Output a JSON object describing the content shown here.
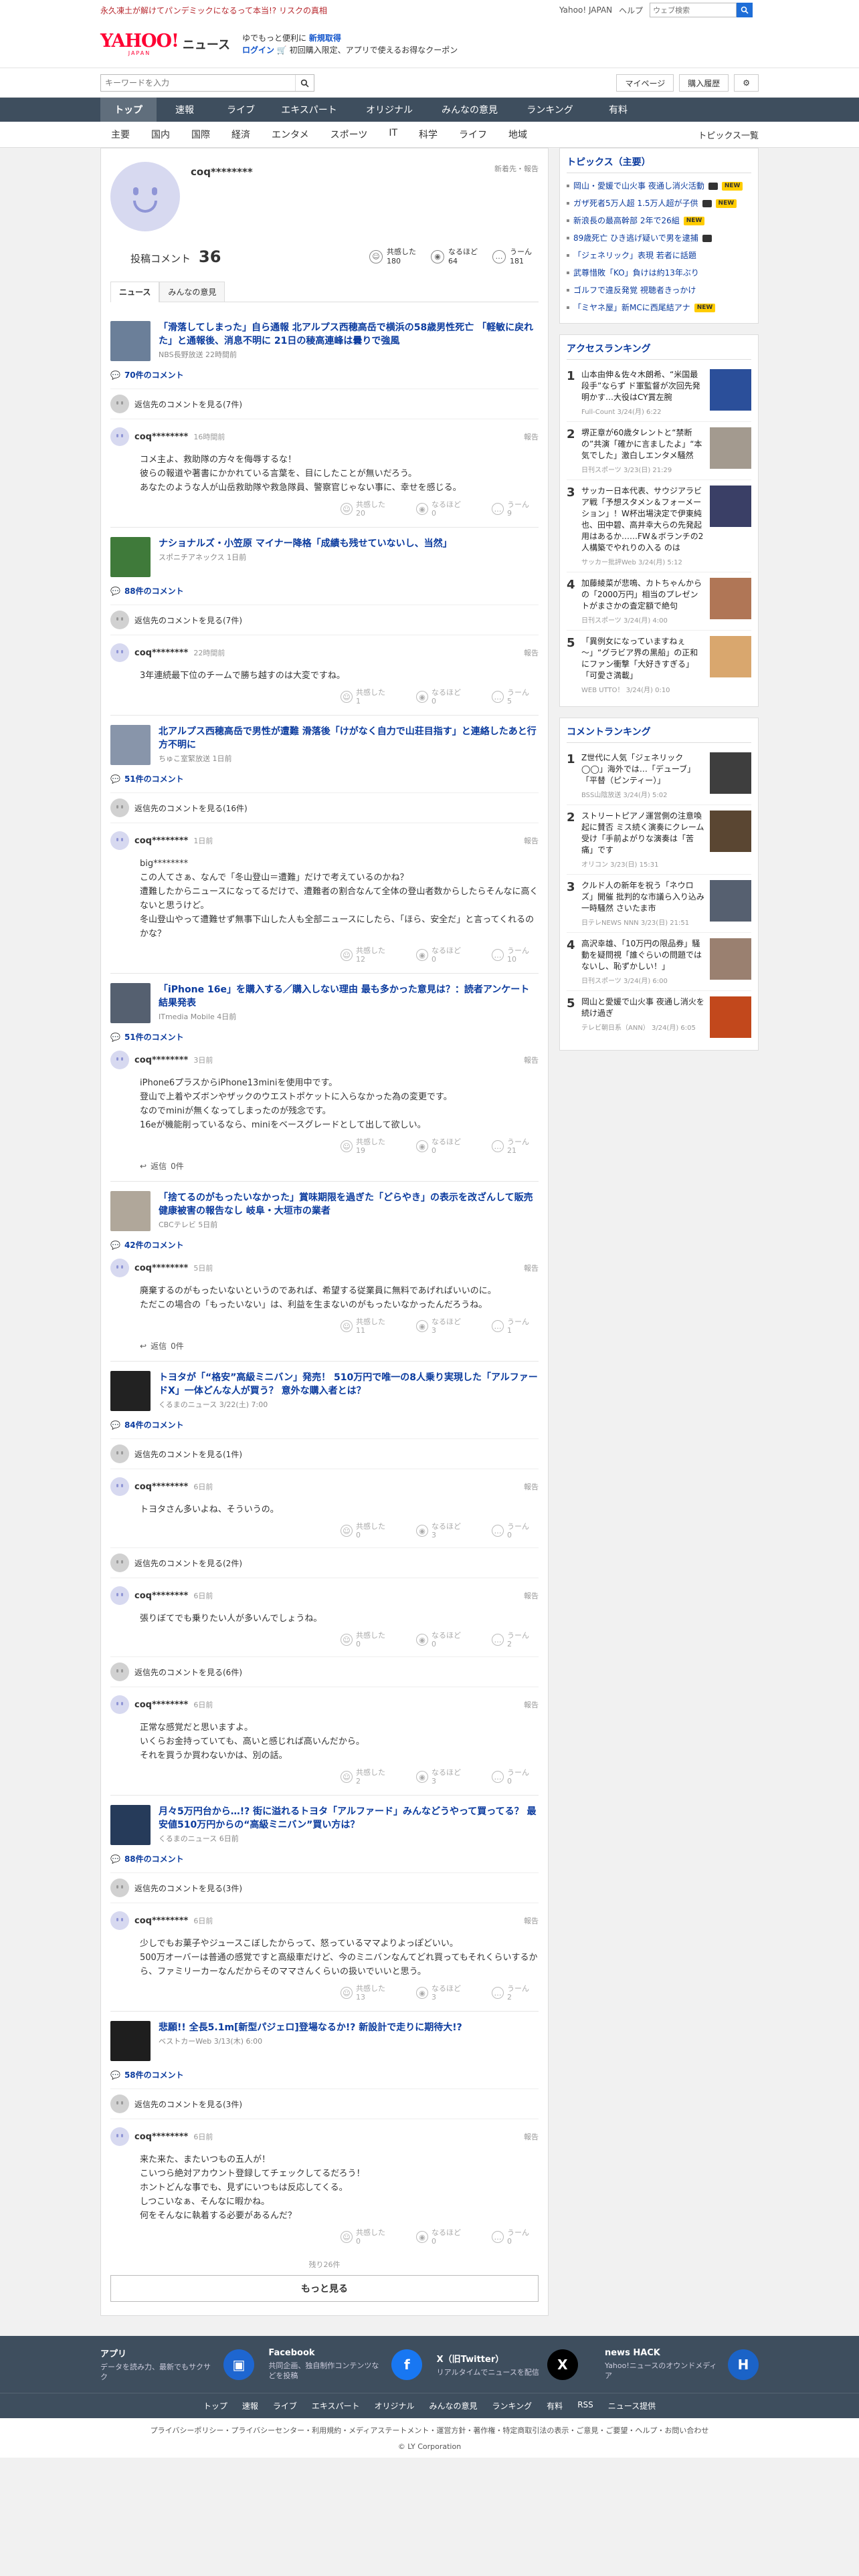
{
  "topbar": {
    "news_link": "永久凍土が解けてパンデミックになるって本当!? リスクの真相",
    "links": [
      "Yahoo! JAPAN",
      "ヘルプ"
    ],
    "search_placeholder": "ウェブ検索"
  },
  "header": {
    "logo": "YAHOO!",
    "logo_sub": "JAPAN",
    "logo_news": "ニュース",
    "promo_line1_a": "ゆでもっと便利に",
    "promo_line1_b": "新規取得",
    "promo_line2_a": "ログイン",
    "promo_line2_b": "初回購入限定、アプリで使えるお得なクーポン"
  },
  "searchrow": {
    "placeholder": "キーワードを入力",
    "mypage": "マイページ",
    "history": "購入履歴"
  },
  "gnav": [
    "トップ",
    "速報",
    "ライブ",
    "エキスパート",
    "オリジナル",
    "みんなの意見",
    "ランキング",
    "有料"
  ],
  "snav": {
    "cats": [
      "主要",
      "国内",
      "国際",
      "経済",
      "エンタメ",
      "スポーツ",
      "IT",
      "科学",
      "ライフ",
      "地域"
    ],
    "all": "トピックス一覧"
  },
  "profile": {
    "name": "coq********",
    "flag": "新着先・報告",
    "post_label": "投稿コメント",
    "post_count": "36",
    "reactions": [
      {
        "label": "共感した",
        "value": "180",
        "icon": "☺"
      },
      {
        "label": "なるほど",
        "value": "64",
        "icon": "◉"
      },
      {
        "label": "うーん",
        "value": "181",
        "icon": "…"
      }
    ],
    "tabs": [
      "ニュース",
      "みんなの意見"
    ]
  },
  "labels": {
    "report": "報告",
    "empathy": "共感した",
    "naruhodo": "なるほど",
    "uun": "うーん",
    "reply_prefix": "返信"
  },
  "articles": [
    {
      "title": "「滑落してしまった」自ら通報 北アルプス西穂高岳で横浜の58歳男性死亡 「軽敏に戻れた」と通報後、消息不明に 21日の稜高連峰は曇りで強風",
      "source": "NBS長野放送 22時間前",
      "thumb": "#6b7f99",
      "ccount": "70件のコメント",
      "blocks": [
        {
          "type": "prev",
          "text": "返信先のコメントを見る(7件)"
        },
        {
          "type": "comment",
          "name": "coq********",
          "time": "16時間前",
          "body": "コメ主よ、救助隊の方々を侮辱するな！\n彼らの報道や著書にかかれている言葉を、目にしたことが無いだろう。\nあなたのような人が山岳救助隊や救急隊員、警察官じゃない事に、幸せを感じる。",
          "a": "20",
          "b": "0",
          "c": "9"
        }
      ]
    },
    {
      "title": "ナショナルズ・小笠原 マイナー降格「成績も残せていないし、当然」",
      "source": "スポニチアネックス 1日前",
      "thumb": "#3f7a3a",
      "ccount": "88件のコメント",
      "blocks": [
        {
          "type": "prev",
          "text": "返信先のコメントを見る(7件)"
        },
        {
          "type": "comment",
          "name": "coq********",
          "time": "22時間前",
          "body": "3年連続最下位のチームで勝ち越すのは大変ですね。",
          "a": "1",
          "b": "0",
          "c": "5"
        }
      ]
    },
    {
      "title": "北アルプス西穂高岳で男性が遭難 滑落後「けがなく自力で山荘目指す」と連絡したあと行方不明に",
      "source": "ちゅこ室緊放送 1日前",
      "thumb": "#8895aa",
      "ccount": "51件のコメント",
      "blocks": [
        {
          "type": "prev",
          "text": "返信先のコメントを見る(16件)"
        },
        {
          "type": "comment",
          "name": "coq********",
          "time": "1日前",
          "body": "big********\nこの人てさぁ、なんで「冬山登山＝遭難」だけで考えているのかね？\n遭難したからニュースになってるだけで、遭難者の割合なんて全体の登山者数からしたらそんなに高くないと思うけど。\n冬山登山やって遭難せず無事下山した人も全部ニュースにしたら、「ほら、安全だ」と言ってくれるのかな？",
          "a": "12",
          "b": "0",
          "c": "10"
        }
      ]
    },
    {
      "title": "「iPhone 16e」を購入する／購入しない理由 最も多かった意見は？：読者アンケート結果発表",
      "source": "ITmedia Mobile 4日前",
      "thumb": "#556070",
      "ccount": "51件のコメント",
      "blocks": [
        {
          "type": "comment",
          "name": "coq********",
          "time": "3日前",
          "body": "iPhone6プラスからiPhone13miniを使用中です。\n登山で上着やズボンやザックのウエストポケットに入らなかった為の変更です。\nなのでminiが無くなってしまったのが残念です。\n16eが機能削っているなら、miniをベースグレードとして出して欲しい。",
          "a": "19",
          "b": "0",
          "c": "21",
          "reply": "0件"
        }
      ]
    },
    {
      "title": "「捨てるのがもったいなかった」賞味期限を過ぎた「どらやき」の表示を改ざんして販売 健康被害の報告なし 岐阜・大垣市の業者",
      "source": "CBCテレビ 5日前",
      "thumb": "#b0a79a",
      "ccount": "42件のコメント",
      "blocks": [
        {
          "type": "comment",
          "name": "coq********",
          "time": "5日前",
          "body": "廃棄するのがもったいないというのであれば、希望する従業員に無料であげればいいのに。\nただこの場合の「もったいない」は、利益を生まないのがもったいなかったんだろうね。",
          "a": "11",
          "b": "3",
          "c": "1",
          "reply": "0件"
        }
      ]
    },
    {
      "title": "トヨタが「“格安”高級ミニバン」発売！ 510万円で唯一の8人乗り実現した「アルファードX」一体どんな人が買う？ 意外な購入者とは？",
      "source": "くるまのニュース 3/22(土) 7:00",
      "thumb": "#222",
      "ccount": "84件のコメント",
      "blocks": [
        {
          "type": "prev",
          "text": "返信先のコメントを見る(1件)"
        },
        {
          "type": "comment",
          "name": "coq********",
          "time": "6日前",
          "body": "トヨタさん多いよね、そういうの。",
          "a": "0",
          "b": "3",
          "c": "0"
        },
        {
          "type": "prev",
          "text": "返信先のコメントを見る(2件)"
        },
        {
          "type": "comment",
          "name": "coq********",
          "time": "6日前",
          "body": "張りぼてでも乗りたい人が多いんでしょうね。",
          "a": "0",
          "b": "0",
          "c": "2"
        },
        {
          "type": "prev",
          "text": "返信先のコメントを見る(6件)"
        },
        {
          "type": "comment",
          "name": "coq********",
          "time": "6日前",
          "body": "正常な感覚だと思いますよ。\nいくらお金持っていても、高いと感じれば高いんだから。\nそれを買うか買わないかは、別の話。",
          "a": "2",
          "b": "3",
          "c": "0"
        }
      ]
    },
    {
      "title": "月々5万円台から…!? 街に溢れるトヨタ「アルファード」みんなどうやって買ってる？ 最安値510万円からの“高級ミニバン”買い方は？",
      "source": "くるまのニュース 6日前",
      "thumb": "#263b5a",
      "ccount": "88件のコメント",
      "blocks": [
        {
          "type": "prev",
          "text": "返信先のコメントを見る(3件)"
        },
        {
          "type": "comment",
          "name": "coq********",
          "time": "6日前",
          "body": "少しでもお菓子やジュースこぼしたからって、怒っているママよりよっぽどいい。\n500万オーバーは普通の感覚ですと高級車だけど、今のミニバンなんてどれ買ってもそれくらいするから、ファミリーカーなんだからそのママさんくらいの扱いでいいと思う。",
          "a": "13",
          "b": "3",
          "c": "2"
        }
      ]
    },
    {
      "title": "悲願!! 全長5.1m[新型パジェロ]登場なるか!? 新設計で走りに期待大!?",
      "source": "ベストカーWeb 3/13(木) 6:00",
      "thumb": "#1e1e1e",
      "ccount": "58件のコメント",
      "blocks": [
        {
          "type": "prev",
          "text": "返信先のコメントを見る(3件)"
        },
        {
          "type": "comment",
          "name": "coq********",
          "time": "6日前",
          "body": "来た来た、またいつもの五人が！\nこいつら絶対アカウント登録してチェックしてるだろう！\nホントどんな事でも、見ずにいつもは反応してくる。\nしつこいなぁ、そんなに暇かね。\n何をそんなに執着する必要があるんだ？",
          "a": "0",
          "b": "0",
          "c": "0"
        }
      ]
    }
  ],
  "more": {
    "info": "残り26件",
    "button": "もっと見る"
  },
  "sidebar": {
    "topics_title": "トピックス（主要）",
    "topics": [
      {
        "text": "岡山・愛媛で山火事 夜通し消火活動",
        "cam": true,
        "new": true
      },
      {
        "text": "ガザ死者5万人超 1.5万人超が子供",
        "cam": true,
        "new": true
      },
      {
        "text": "新浪長の最高幹部 2年で26組",
        "cam": false,
        "new": true
      },
      {
        "text": "89歳死亡 ひき逃げ疑いで男を逮捕",
        "cam": true,
        "new": false
      },
      {
        "text": "「ジェネリック」表現 若者に話題",
        "cam": false,
        "new": false
      },
      {
        "text": "武尊惜敗「KO」負けは約13年ぶり",
        "cam": false,
        "new": false
      },
      {
        "text": "ゴルフで違反発覚 視聴者きっかけ",
        "cam": false,
        "new": false
      },
      {
        "text": "「ミヤネ屋」新MCに西尾結アナ",
        "cam": false,
        "new": true
      }
    ],
    "access_title": "アクセスランキング",
    "access": [
      {
        "n": "1",
        "t": "山本由伸＆佐々木朗希、“米国最段手”ならず ド軍監督が次回先発明かす…大役はCY賞左腕",
        "s": "Full-Count 3/24(月) 6:22",
        "c": "#2b4f9a"
      },
      {
        "n": "2",
        "t": "堺正章が60歳タレントと“禁断の”共演「確かに言ましたよ」“本気でした」激白しエンタメ騒然",
        "s": "日刊スポーツ 3/23(日) 21:29",
        "c": "#a39a8f"
      },
      {
        "n": "3",
        "t": "サッカー日本代表、サウジアラビア戦「予想スタメン＆フォーメーション」！W杯出場決定で伊東純也、田中碧、高井幸大らの先発起用はあるか……FW＆ボランチの2人構築でやれりの入る のは",
        "s": "サッカー批評Web 3/24(月) 5:12",
        "c": "#3a3f66"
      },
      {
        "n": "4",
        "t": "加藤綾菜が悲鳴、カトちゃんからの「2000万円」相当のプレゼントがまさかの査定額で絶句",
        "s": "日刊スポーツ 3/24(月) 4:00",
        "c": "#b07656"
      },
      {
        "n": "5",
        "t": "「異例女になっていますねぇ～」“グラビア界の黒船」の正和にファン衝撃「大好きすぎる」「可愛さ満載」",
        "s": "WEB UTTO！ 3/24(月) 0:10",
        "c": "#d9a76e"
      }
    ],
    "comment_title": "コメントランキング",
    "comment_rank": [
      {
        "n": "1",
        "t": "Z世代に人気「ジェネリック◯◯」海外では…「デューブ」「平替（ピンティー）」",
        "s": "BSS山陰放送 3/24(月) 5:02",
        "c": "#3e3e3e"
      },
      {
        "n": "2",
        "t": "ストリートピアノ運営側の注意喚起に賛否 ミス続く演奏にクレーム受け「手前よがりな演奏は「苦痛」です",
        "s": "オリコン 3/23(日) 15:31",
        "c": "#5a4632"
      },
      {
        "n": "3",
        "t": "クルド人の新年を祝う「ネウロズ」開催 批判的な市議ら入り込み一時騒然 さいたま市",
        "s": "日テレNEWS NNN 3/23(日) 21:51",
        "c": "#566070"
      },
      {
        "n": "4",
        "t": "高沢幸雄、「10万円の限品券」騒動を疑問視「誰ぐらいの問題ではないし、恥ずかしい！」",
        "s": "日刊スポーツ 3/24(月) 6:00",
        "c": "#9a8070"
      },
      {
        "n": "5",
        "t": "岡山と愛媛で山火事 夜通し消火を続け過ぎ",
        "s": "テレビ朝日系（ANN） 3/24(月) 6:05",
        "c": "#c2481c"
      }
    ]
  },
  "footer": {
    "cols": [
      {
        "title": "アプリ",
        "desc": "データを読み力、最新でもサクサク",
        "icon": "app-icon",
        "color": "#1e66d0",
        "glyph": "▣"
      },
      {
        "title": "Facebook",
        "desc": "共同企画、独自制作コンテンツなどを投稿",
        "icon": "facebook-icon",
        "color": "#1877f2",
        "glyph": "f"
      },
      {
        "title": "X（旧Twitter）",
        "desc": "リアルタイムでニュースを配信",
        "icon": "x-icon",
        "color": "#000",
        "glyph": "X"
      },
      {
        "title": "news HACK",
        "desc": "Yahoo!ニュースのオウンドメディア",
        "icon": "hack-icon",
        "color": "#1b63c7",
        "glyph": "H"
      }
    ],
    "nav": [
      "トップ",
      "速報",
      "ライブ",
      "エキスパート",
      "オリジナル",
      "みんなの意見",
      "ランキング",
      "有料",
      "RSS",
      "ニュース提供"
    ],
    "legal": "プライバシーポリシー・プライバシーセンター・利用規約・メディアステートメント・運営方針・著作権・特定商取引法の表示・ご意見・ご要望・ヘルプ・お問い合わせ",
    "copy": "© LY Corporation"
  }
}
